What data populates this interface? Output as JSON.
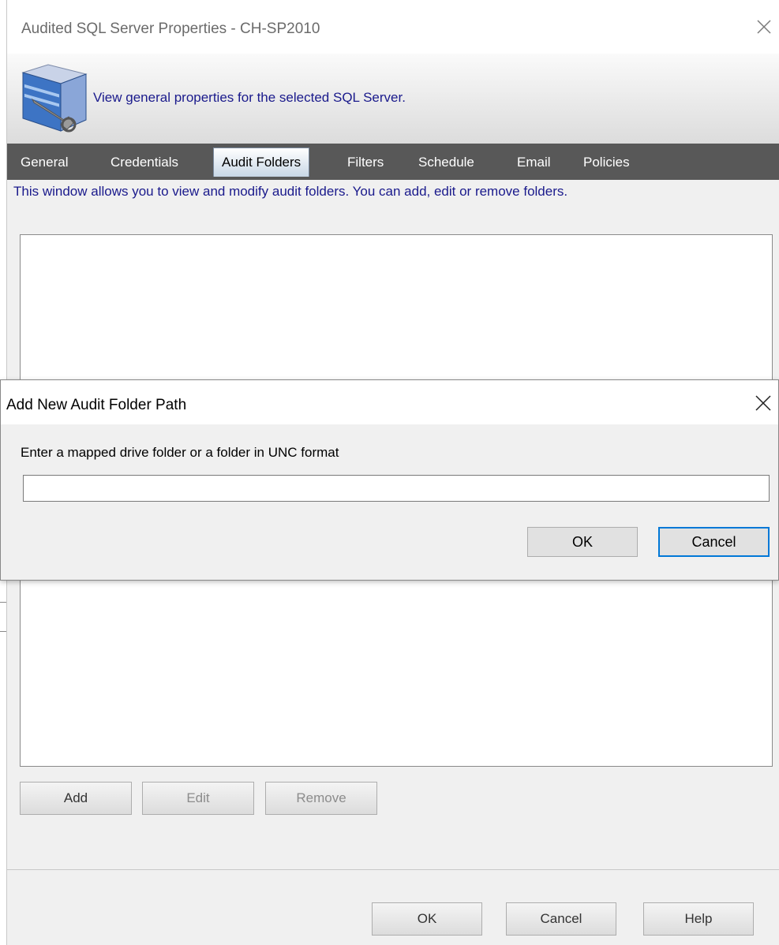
{
  "main_window": {
    "title": "Audited SQL Server Properties - CH-SP2010",
    "header_description": "View general properties for the selected SQL Server.",
    "tabs": [
      {
        "label": "General",
        "active": false
      },
      {
        "label": "Credentials",
        "active": false
      },
      {
        "label": "Audit Folders",
        "active": true
      },
      {
        "label": "Filters",
        "active": false
      },
      {
        "label": "Schedule",
        "active": false
      },
      {
        "label": "Email",
        "active": false
      },
      {
        "label": "Policies",
        "active": false
      }
    ],
    "info_text": "This window allows you to view and modify audit folders.  You can add, edit or remove folders.",
    "folder_buttons": {
      "add": "Add",
      "edit": "Edit",
      "remove": "Remove"
    },
    "footer_buttons": {
      "ok": "OK",
      "cancel": "Cancel",
      "help": "Help"
    }
  },
  "dialog": {
    "title": "Add New Audit Folder Path",
    "prompt": "Enter a mapped drive folder or a folder in UNC format",
    "input_value": "",
    "ok_label": "OK",
    "cancel_label": "Cancel"
  },
  "colors": {
    "tab_strip": "#585858",
    "description_text": "#1a1a8c",
    "default_button_border": "#0078d7"
  }
}
